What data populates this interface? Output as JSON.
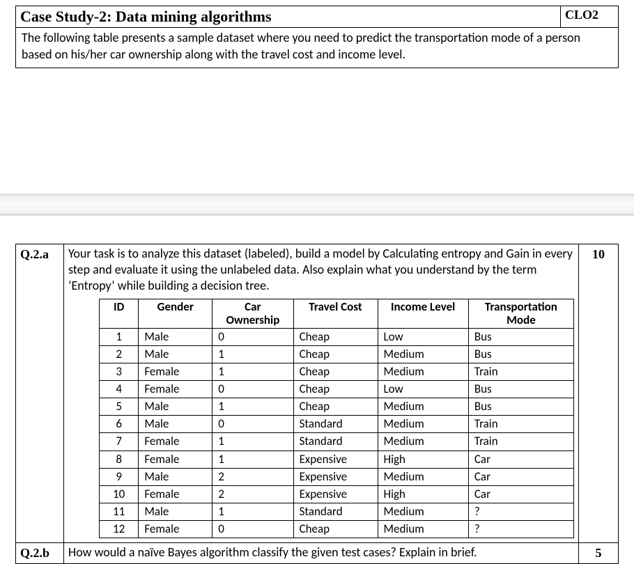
{
  "header": {
    "title": "Case Study-2: Data mining algorithms",
    "clo": "CLO2",
    "description": "The following table presents a sample dataset where you need to predict the transportation mode of a person based on his/her car ownership along with the travel cost and income level."
  },
  "q2a": {
    "label": "Q.2.a",
    "text": "Your task is to analyze this dataset (labeled), build a model by Calculating entropy and Gain in every step and evaluate it using the unlabeled data. Also explain what you understand by the term ‘Entropy’ while building a decision tree.",
    "marks": "10",
    "table": {
      "headers": [
        "ID",
        "Gender",
        "Car Ownership",
        "Travel Cost",
        "Income Level",
        "Transportation Mode"
      ],
      "rows": [
        {
          "id": "1",
          "gender": "Male",
          "car": "0",
          "cost": "Cheap",
          "income": "Low",
          "mode": "Bus"
        },
        {
          "id": "2",
          "gender": "Male",
          "car": "1",
          "cost": "Cheap",
          "income": "Medium",
          "mode": "Bus"
        },
        {
          "id": "3",
          "gender": "Female",
          "car": "1",
          "cost": "Cheap",
          "income": "Medium",
          "mode": "Train"
        },
        {
          "id": "4",
          "gender": "Female",
          "car": "0",
          "cost": "Cheap",
          "income": "Low",
          "mode": "Bus"
        },
        {
          "id": "5",
          "gender": "Male",
          "car": "1",
          "cost": "Cheap",
          "income": "Medium",
          "mode": "Bus"
        },
        {
          "id": "6",
          "gender": "Male",
          "car": "0",
          "cost": "Standard",
          "income": "Medium",
          "mode": "Train"
        },
        {
          "id": "7",
          "gender": "Female",
          "car": "1",
          "cost": "Standard",
          "income": "Medium",
          "mode": "Train"
        },
        {
          "id": "8",
          "gender": "Female",
          "car": "1",
          "cost": "Expensive",
          "income": "High",
          "mode": "Car"
        },
        {
          "id": "9",
          "gender": "Male",
          "car": "2",
          "cost": "Expensive",
          "income": "Medium",
          "mode": "Car"
        },
        {
          "id": "10",
          "gender": "Female",
          "car": "2",
          "cost": "Expensive",
          "income": "High",
          "mode": "Car"
        },
        {
          "id": "11",
          "gender": "Male",
          "car": "1",
          "cost": "Standard",
          "income": "Medium",
          "mode": "?"
        },
        {
          "id": "12",
          "gender": "Female",
          "car": "0",
          "cost": "Cheap",
          "income": "Medium",
          "mode": "?"
        }
      ]
    }
  },
  "q2b": {
    "label": "Q.2.b",
    "text": "How would a naïve Bayes algorithm classify the given test cases? Explain in brief.",
    "marks": "5"
  }
}
